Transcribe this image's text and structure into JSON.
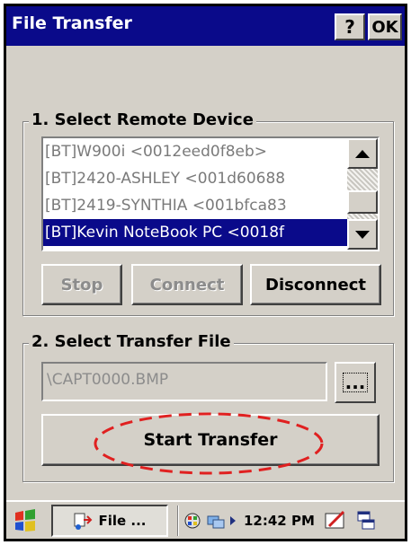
{
  "window": {
    "title": "File Transfer",
    "help_label": "?",
    "ok_label": "OK"
  },
  "remote_device": {
    "group_title": "1. Select Remote Device",
    "devices": [
      {
        "label": "[BT]W900i <0012eed0f8eb>",
        "selected": false
      },
      {
        "label": "[BT]2420-ASHLEY <001d60688",
        "selected": false
      },
      {
        "label": "[BT]2419-SYNTHIA <001bfca83",
        "selected": false
      },
      {
        "label": "[BT]Kevin NoteBook PC <0018f",
        "selected": true
      }
    ],
    "buttons": {
      "stop": "Stop",
      "connect": "Connect",
      "disconnect": "Disconnect"
    }
  },
  "transfer_file": {
    "group_title": "2. Select Transfer File",
    "file_path": "\\CAPT0000.BMP",
    "browse_label": "...",
    "start_label": "Start Transfer"
  },
  "taskbar": {
    "task_label": "File ...",
    "clock": "12:42 PM"
  },
  "colors": {
    "title_bar": "#0a0a8a",
    "selection": "#0a0a8a",
    "face": "#d4d0c8",
    "highlight_ellipse": "#e02020"
  }
}
